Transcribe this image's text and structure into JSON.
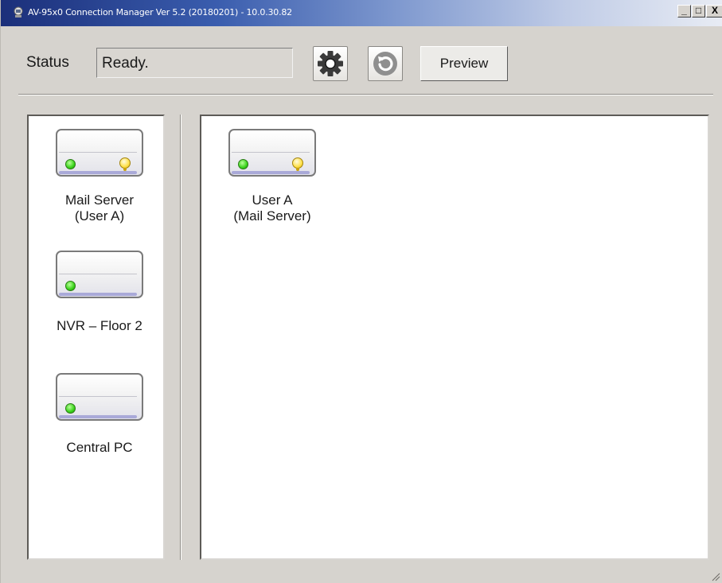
{
  "window": {
    "title": "AV-95x0 Connection Manager Ver 5.2 (20180201) - 10.0.30.82",
    "minimize": "_",
    "maximize": "□",
    "close": "X"
  },
  "toolbar": {
    "status_label": "Status",
    "status_value": "Ready.",
    "settings_icon": "gear-icon",
    "refresh_icon": "refresh-icon",
    "preview_label": "Preview"
  },
  "device_list": [
    {
      "name": "Mail Server",
      "sub": "(User A)",
      "green_led": true,
      "yellow_led": true
    },
    {
      "name": "NVR – Floor 2",
      "sub": "",
      "green_led": true,
      "yellow_led": false
    },
    {
      "name": "Central PC",
      "sub": "",
      "green_led": true,
      "yellow_led": false
    }
  ],
  "connected": [
    {
      "name": "User A",
      "sub": "(Mail Server)",
      "green_led": true,
      "yellow_led": true
    }
  ],
  "colors": {
    "title_gradient_start": "#1b2f7a",
    "led_green": "#39d31a",
    "led_yellow": "#ffe14a"
  }
}
